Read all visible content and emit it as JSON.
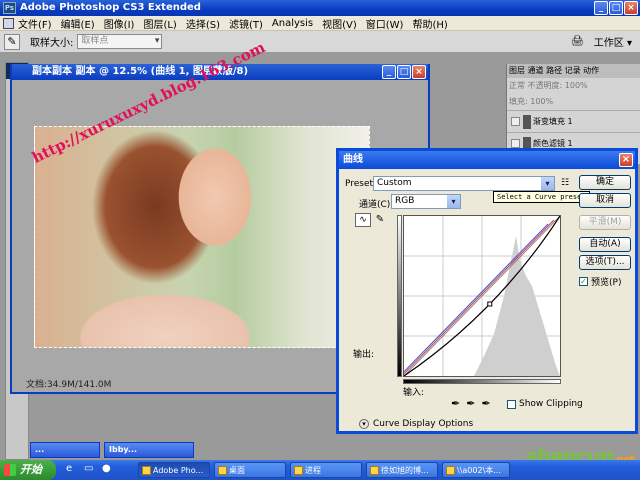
{
  "app": {
    "title": "Adobe Photoshop CS3 Extended",
    "menu": [
      "文件(F)",
      "编辑(E)",
      "图像(I)",
      "图层(L)",
      "选择(S)",
      "滤镜(T)",
      "Analysis",
      "视图(V)",
      "窗口(W)",
      "帮助(H)"
    ]
  },
  "options_bar": {
    "sample_label": "取样大小:",
    "sample_value": "取样点",
    "workspace_label": "工作区 ▾"
  },
  "tools": {
    "logo": "Ps",
    "glyphs": [
      "▭",
      "◌",
      "✂",
      "⌖",
      "✎",
      "⌫",
      "◐",
      "◈",
      "T",
      "✦",
      "▢",
      "✋",
      "⌕"
    ]
  },
  "document": {
    "title": "副本副本 副本 @ 12.5% (曲线 1, 图层蒙版/8)",
    "status": "文档:34.9M/141.0M",
    "watermark": "http://xuruxuxyd.blog.163.com"
  },
  "layers_panel": {
    "tabs": "图层 通道 路径 记录 动作",
    "blend": "正常",
    "opacity": "不透明度: 100%",
    "fill": "填充: 100%",
    "rows": [
      "渐变填充 1",
      "颜色滤镜 1"
    ]
  },
  "curves_dialog": {
    "title": "曲线",
    "preset_label": "Preset:",
    "preset_value": "Custom",
    "tooltip": "Select a Curve preset",
    "channel_label": "通道(C):",
    "channel_value": "RGB",
    "output_label": "输出:",
    "input_label": "输入:",
    "show_clipping": "Show Clipping",
    "curve_display_options": "Curve Display Options",
    "buttons": {
      "ok": "确定",
      "cancel": "取消",
      "smooth": "平滑(M)",
      "auto": "自动(A)",
      "options": "选项(T)...",
      "preview": "预览(P)"
    },
    "curve_points": [
      [
        0,
        0
      ],
      [
        0.55,
        0.45
      ],
      [
        1,
        1
      ]
    ]
  },
  "minimized": {
    "win1": "...",
    "win2": "Ibby..."
  },
  "taskbar": {
    "start": "开始",
    "buttons": [
      "Adobe Pho...",
      "桌面",
      "进程",
      "徐如旭的博...",
      "\\\\a002\\本..."
    ]
  },
  "brand": {
    "main": "shancun",
    "suffix": ".net"
  }
}
